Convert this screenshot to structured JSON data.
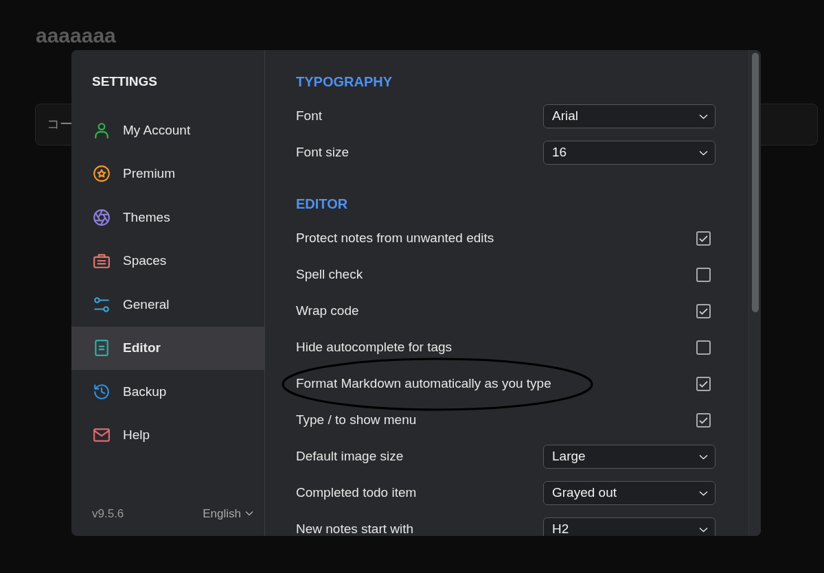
{
  "background_page": {
    "heading": "aaaaaaa",
    "field_text": "コー"
  },
  "settings": {
    "title": "SETTINGS",
    "nav": [
      {
        "kind": "account",
        "label": "My Account",
        "color": "#2fb84a",
        "selected": false
      },
      {
        "kind": "premium",
        "label": "Premium",
        "color": "#f0962e",
        "selected": false
      },
      {
        "kind": "themes",
        "label": "Themes",
        "color": "#8a7fd8",
        "selected": false
      },
      {
        "kind": "spaces",
        "label": "Spaces",
        "color": "#e0776e",
        "selected": false
      },
      {
        "kind": "general",
        "label": "General",
        "color": "#3ea3d8",
        "selected": false
      },
      {
        "kind": "editor",
        "label": "Editor",
        "color": "#2fb0a8",
        "selected": true
      },
      {
        "kind": "backup",
        "label": "Backup",
        "color": "#2e8fe0",
        "selected": false
      },
      {
        "kind": "help",
        "label": "Help",
        "color": "#e06a70",
        "selected": false
      }
    ],
    "version": "v9.5.6",
    "language": "English",
    "sections": [
      {
        "title": "TYPOGRAPHY",
        "rows": [
          {
            "kind": "select",
            "label": "Font",
            "value": "Arial"
          },
          {
            "kind": "select",
            "label": "Font size",
            "value": "16"
          }
        ]
      },
      {
        "title": "EDITOR",
        "rows": [
          {
            "kind": "checkbox",
            "label": "Protect notes from unwanted edits",
            "checked": true
          },
          {
            "kind": "checkbox",
            "label": "Spell check",
            "checked": false
          },
          {
            "kind": "checkbox",
            "label": "Wrap code",
            "checked": true
          },
          {
            "kind": "checkbox",
            "label": "Hide autocomplete for tags",
            "checked": false
          },
          {
            "kind": "checkbox",
            "label": "Format Markdown automatically as you type",
            "checked": true
          },
          {
            "kind": "checkbox",
            "label": "Type / to show menu",
            "checked": true
          },
          {
            "kind": "select",
            "label": "Default image size",
            "value": "Large"
          },
          {
            "kind": "select",
            "label": "Completed todo item",
            "value": "Grayed out"
          },
          {
            "kind": "select",
            "label": "New notes start with",
            "value": "H2"
          }
        ]
      }
    ]
  }
}
